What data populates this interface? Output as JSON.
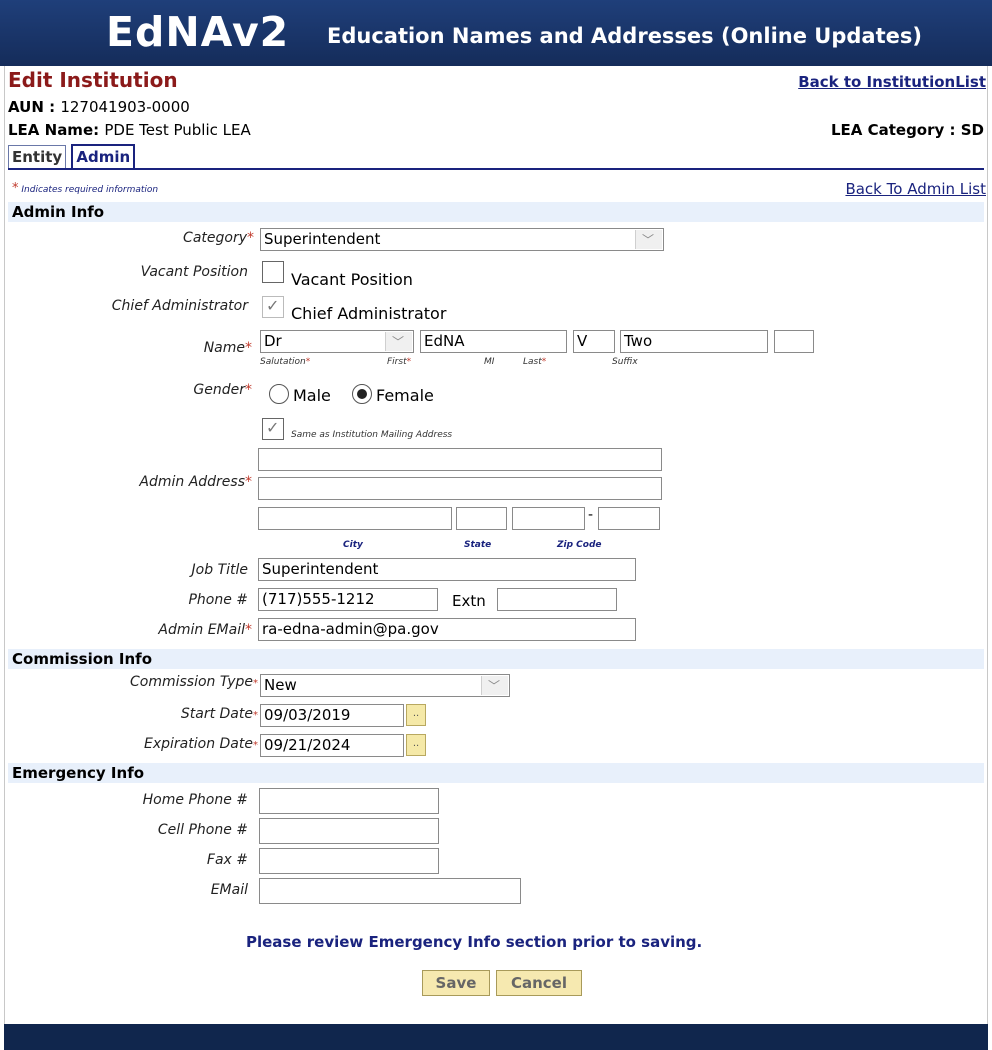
{
  "header": {
    "logo": "EdNAv2",
    "tagline": "Education Names and Addresses (Online Updates)"
  },
  "page": {
    "title": "Edit Institution",
    "back_to_institution_list": "Back to InstitutionList",
    "aun_label": "AUN : ",
    "aun_value": "127041903-0000",
    "lea_name_label": "LEA Name: ",
    "lea_name_value": "PDE Test Public LEA",
    "lea_category_label": "LEA Category : ",
    "lea_category_value": "SD",
    "tabs": [
      {
        "label": "Entity",
        "active": false
      },
      {
        "label": "Admin",
        "active": true
      }
    ],
    "required_note": "Indicates required information",
    "back_to_admin_list": "Back To Admin List"
  },
  "admin_info": {
    "section_title": "Admin Info",
    "category": {
      "label": "Category",
      "value": "Superintendent"
    },
    "vacant": {
      "label": "Vacant Position",
      "checkbox_label": "Vacant Position",
      "checked": false
    },
    "chief": {
      "label": "Chief Administrator",
      "checkbox_label": "Chief Administrator",
      "checked": true
    },
    "name": {
      "label": "Name",
      "salutation": "Dr",
      "first": "EdNA",
      "mi": "V",
      "last": "Two",
      "suffix": "",
      "sub_salutation": "Salutation",
      "sub_first": "First",
      "sub_mi": "MI",
      "sub_last": "Last",
      "sub_suffix": "Suffix"
    },
    "gender": {
      "label": "Gender",
      "male": "Male",
      "female": "Female",
      "selected": "Female"
    },
    "same_as_mailing": {
      "label": "Same as Institution Mailing Address",
      "checked": true
    },
    "address": {
      "label": "Admin Address",
      "line1": "",
      "line2": "",
      "city": "",
      "state": "",
      "zip": "",
      "zip4": "",
      "sub_city": "City",
      "sub_state": "State",
      "sub_zip": "Zip Code"
    },
    "job_title": {
      "label": "Job Title",
      "value": "Superintendent"
    },
    "phone": {
      "label": "Phone #",
      "value": "(717)555-1212",
      "extn_label": "Extn",
      "extn_value": ""
    },
    "email": {
      "label": "Admin EMail",
      "value": "ra-edna-admin@pa.gov"
    }
  },
  "commission_info": {
    "section_title": "Commission Info",
    "type": {
      "label": "Commission Type",
      "value": "New"
    },
    "start": {
      "label": "Start Date",
      "value": "09/03/2019",
      "button": ".."
    },
    "expiration": {
      "label": "Expiration Date",
      "value": "09/21/2024",
      "button": ".."
    }
  },
  "emergency_info": {
    "section_title": "Emergency Info",
    "home_phone": {
      "label": "Home Phone #",
      "value": ""
    },
    "cell_phone": {
      "label": "Cell Phone #",
      "value": ""
    },
    "fax": {
      "label": "Fax #",
      "value": ""
    },
    "email": {
      "label": "EMail",
      "value": ""
    }
  },
  "footer_note": "Please review Emergency Info section prior to saving.",
  "buttons": {
    "save": "Save",
    "cancel": "Cancel"
  },
  "icons": {
    "dropdown": "chevron-down-icon",
    "calendar": "calendar-icon",
    "required": "asterisk-icon"
  },
  "colors": {
    "header_bg": "#1f3f7a",
    "title": "#8b1a1a",
    "link": "#1a237e",
    "section_bg": "#e8f0fb",
    "button_bg": "#f6e9b0",
    "required_star": "#c0392b"
  }
}
